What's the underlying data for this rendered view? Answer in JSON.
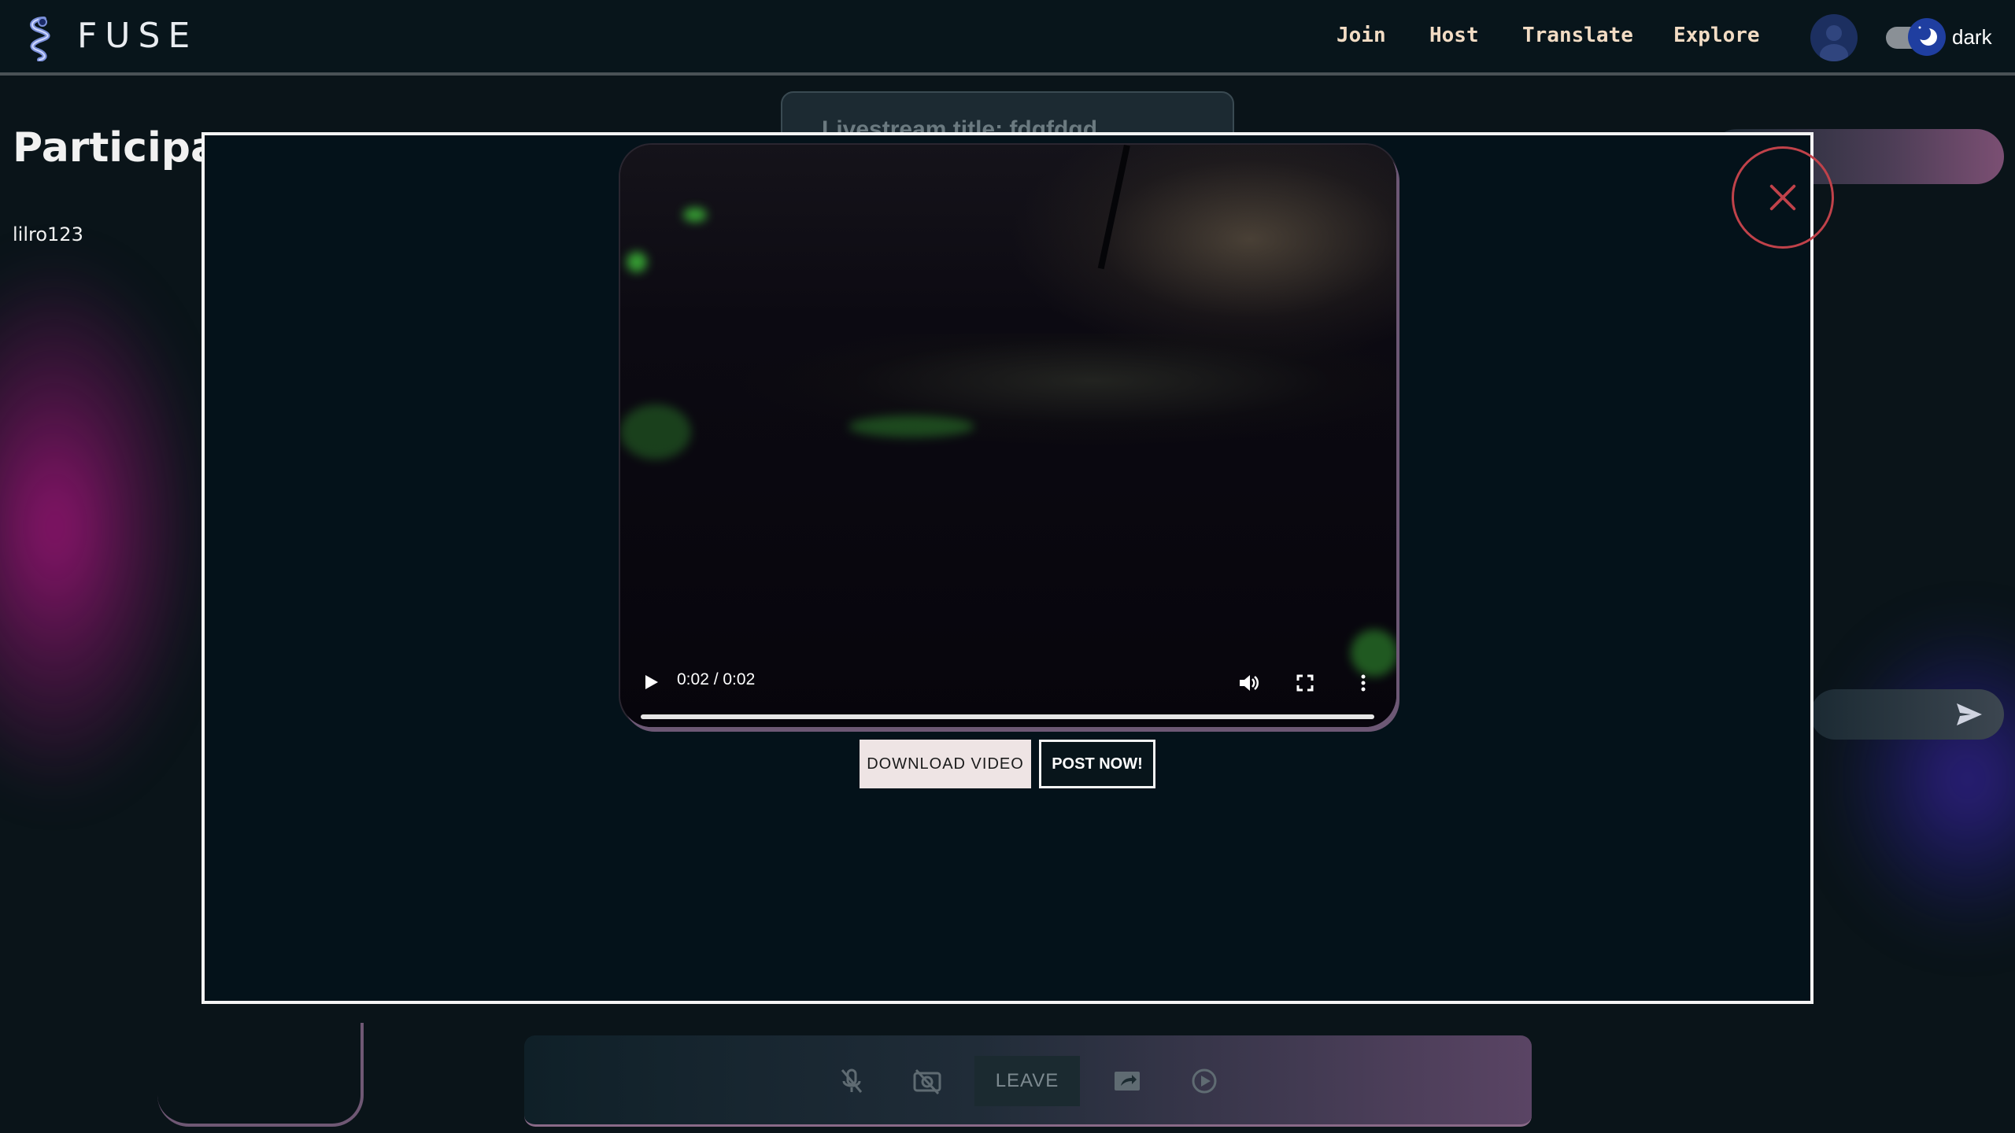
{
  "header": {
    "brand": "FUSE",
    "nav": [
      {
        "label": "Join"
      },
      {
        "label": "Host"
      },
      {
        "label": "Translate"
      },
      {
        "label": "Explore"
      }
    ],
    "theme_label": "dark"
  },
  "sidebar": {
    "title": "Participan",
    "participants": [
      "lilro123"
    ]
  },
  "stream": {
    "title": "Livestream title: fdgfdgd"
  },
  "controls": {
    "leave_label": "LEAVE"
  },
  "modal": {
    "video": {
      "time": "0:02 / 0:02",
      "progress": 1.0
    },
    "download_label": "DOWNLOAD VIDEO",
    "post_label": "POST NOW!"
  },
  "colors": {
    "accent_nav": "#f2dcc4",
    "close_red": "#c0424a",
    "modal_bg": "#04121a"
  }
}
